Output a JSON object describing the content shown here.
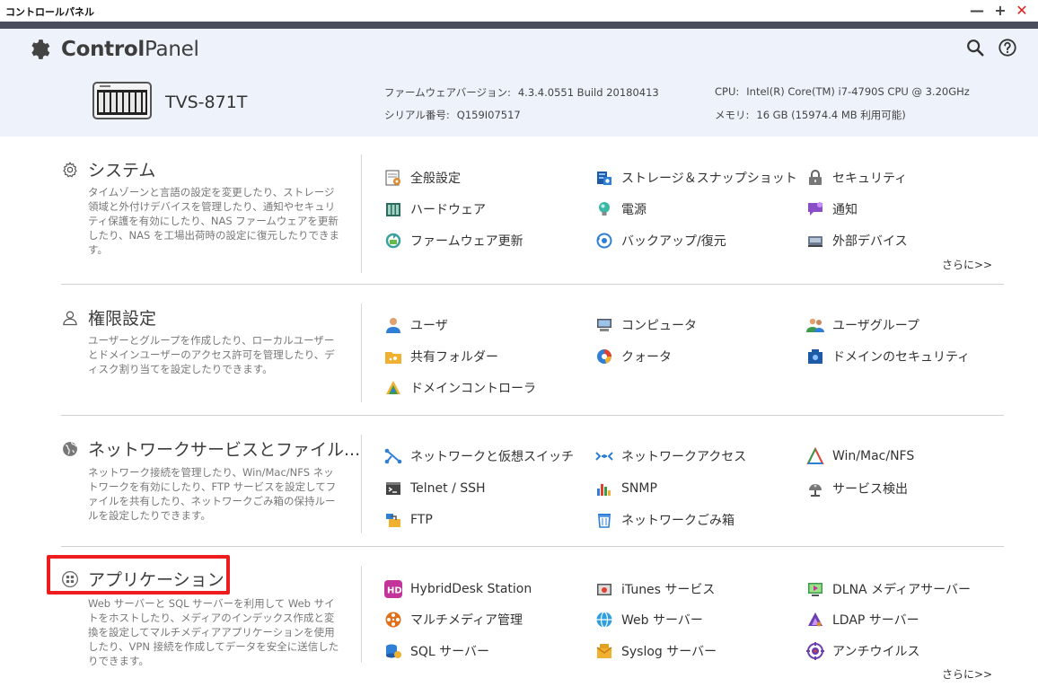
{
  "window": {
    "title": "コントロールパネル"
  },
  "header": {
    "brand_bold": "Control",
    "brand_light": "Panel",
    "model": "TVS-871T",
    "firmware_label": "ファームウェアバージョン:",
    "firmware_value": "4.3.4.0551 Build 20180413",
    "serial_label": "シリアル番号:",
    "serial_value": "Q159I07517",
    "cpu_label": "CPU:",
    "cpu_value": "Intel(R) Core(TM) i7-4790S CPU @ 3.20GHz",
    "memory_label": "メモリ:",
    "memory_value": "16 GB (15974.4 MB 利用可能)"
  },
  "sections": {
    "system": {
      "title": "システム",
      "desc": "タイムゾーンと言語の設定を変更したり、ストレージ領域と外付けデバイスを管理したり、通知やセキュリティ保護を有効にしたり、NAS ファームウェアを更新したり、NAS を工場出荷時の設定に復元したりできます。",
      "items": [
        "全般設定",
        "ストレージ＆スナップショット",
        "セキュリティ",
        "ハードウェア",
        "電源",
        "通知",
        "ファームウェア更新",
        "バックアップ/復元",
        "外部デバイス"
      ],
      "more": "さらに>>"
    },
    "privilege": {
      "title": "権限設定",
      "desc": "ユーザーとグループを作成したり、ローカルユーザーとドメインユーザーのアクセス許可を管理したり、ディスク割り当てを設定したりできます。",
      "items": [
        "ユーザ",
        "コンピュータ",
        "ユーザグループ",
        "共有フォルダー",
        "クォータ",
        "ドメインのセキュリティ",
        "ドメインコントローラ"
      ]
    },
    "network": {
      "title": "ネットワークサービスとファイル...",
      "desc": "ネットワーク接続を管理したり、Win/Mac/NFS ネットワークを有効にしたり、FTP サービスを設定してファイルを共有したり、ネットワークごみ箱の保持ルールを設定したりできます。",
      "items": [
        "ネットワークと仮想スイッチ",
        "ネットワークアクセス",
        "Win/Mac/NFS",
        "Telnet / SSH",
        "SNMP",
        "サービス検出",
        "FTP",
        "ネットワークごみ箱"
      ]
    },
    "application": {
      "title": "アプリケーション",
      "desc": "Web サーバーと SQL サーバーを利用して Web サイトをホストしたり、メディアのインデックス作成と変換を設定してマルチメディアアプリケーションを使用したり、VPN 接続を作成してデータを安全に送信したりできます。",
      "items": [
        "HybridDesk Station",
        "iTunes サービス",
        "DLNA メディアサーバー",
        "マルチメディア管理",
        "Web サーバー",
        "LDAP サーバー",
        "SQL サーバー",
        "Syslog サーバー",
        "アンチウイルス"
      ],
      "more": "さらに>>"
    }
  },
  "colors": {
    "highlight": "#ee1c1c",
    "header_bg": "#eef3fb",
    "accent_blue": "#2f7fd6"
  }
}
